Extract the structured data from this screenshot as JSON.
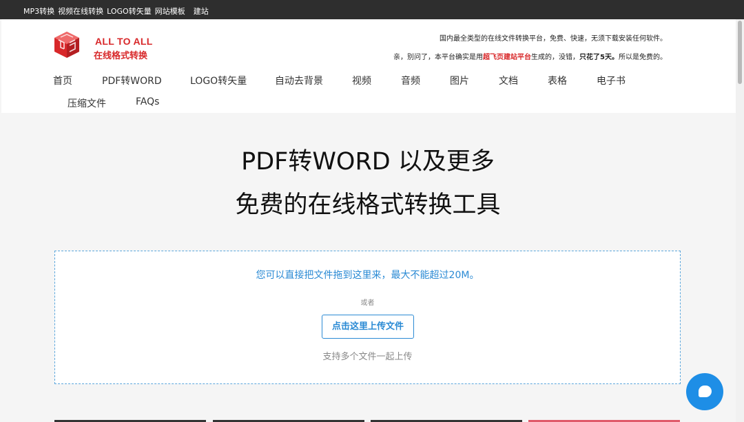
{
  "topbar": {
    "links": [
      "MP3转换",
      "视频在线转换",
      "LOGO转矢量",
      "网站模板",
      "建站"
    ]
  },
  "logo": {
    "en": "ALL TO ALL",
    "cn": "在线格式转换",
    "icon": "cube-logo-icon",
    "color": "#d8282a"
  },
  "tagline": {
    "line1": "国内最全类型的在线文件转换平台，免费、快速，无须下载安装任何软件。",
    "line2_pre": "亲，别问了，本平台确实是用",
    "line2_highlight": "超飞页建站平台",
    "line2_mid": "生成的，没错，",
    "line2_bold": "只花了5天。",
    "line2_post": "所以是免费的。"
  },
  "nav": {
    "items": [
      "首页",
      "PDF转WORD",
      "LOGO转矢量",
      "自动去背景",
      "视频",
      "音频",
      "图片",
      "文档",
      "表格",
      "电子书",
      "压缩文件",
      "FAQs"
    ]
  },
  "hero": {
    "line1": "PDF转WORD 以及更多",
    "line2": "免费的在线格式转换工具"
  },
  "dropzone": {
    "main": "您可以直接把文件拖到这里来，最大不能超过20M。",
    "or": "或者",
    "button": "点击这里上传文件",
    "sub": "支持多个文件一起上传"
  },
  "chat": {
    "icon": "chat-bubble-icon",
    "color": "#1e8ee6"
  },
  "colors": {
    "accent": "#2a8ad4",
    "topbar": "#2e2e2e",
    "brand": "#d8282a"
  }
}
